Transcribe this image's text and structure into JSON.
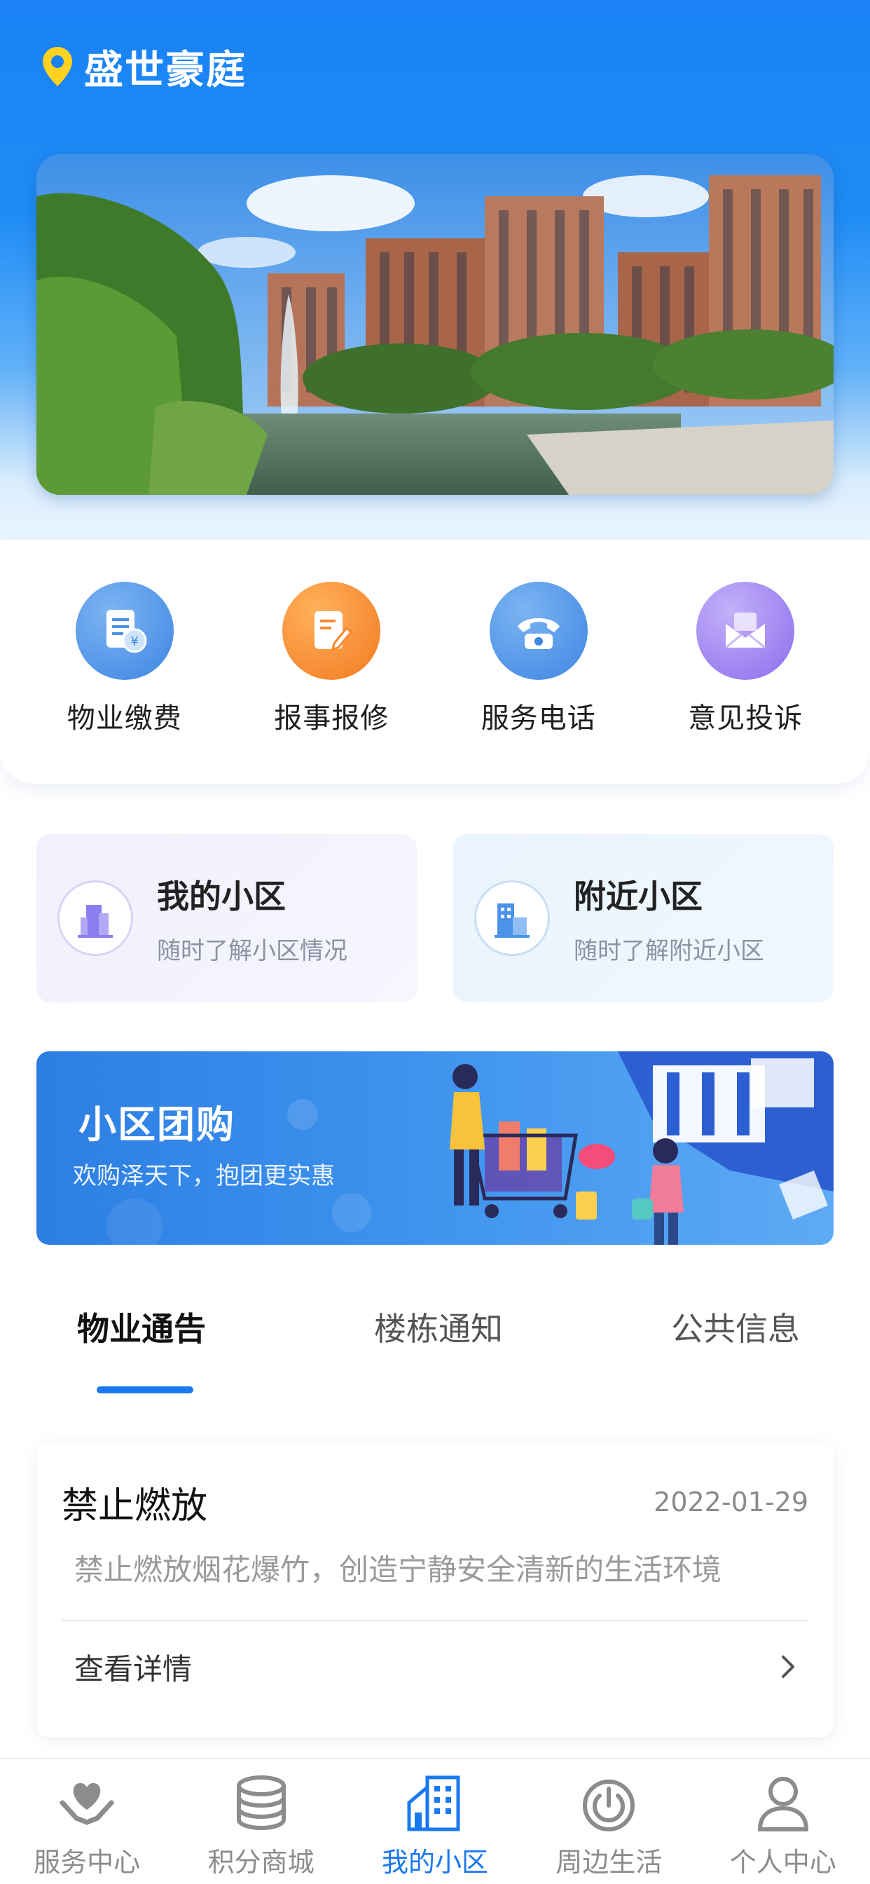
{
  "header": {
    "community_name": "盛世豪庭",
    "location_icon": "location-pin-icon"
  },
  "quick_actions": [
    {
      "label": "物业缴费",
      "icon": "bill-payment-icon",
      "color": "#4a93e8"
    },
    {
      "label": "报事报修",
      "icon": "repair-report-icon",
      "color": "#f5882d"
    },
    {
      "label": "服务电话",
      "icon": "telephone-icon",
      "color": "#4a93e8"
    },
    {
      "label": "意见投诉",
      "icon": "envelope-icon",
      "color": "#9a7df0"
    }
  ],
  "community_cards": [
    {
      "title": "我的小区",
      "subtitle": "随时了解小区情况",
      "icon": "building-icon"
    },
    {
      "title": "附近小区",
      "subtitle": "随时了解附近小区",
      "icon": "nearby-building-icon"
    }
  ],
  "group_buy": {
    "title": "小区团购",
    "subtitle": "欢购泽天下，抱团更实惠"
  },
  "tabs": [
    {
      "label": "物业通告",
      "active": true
    },
    {
      "label": "楼栋通知",
      "active": false
    },
    {
      "label": "公共信息",
      "active": false
    }
  ],
  "notice": {
    "title": "禁止燃放",
    "date": "2022-01-29",
    "body": "禁止燃放烟花爆竹，创造宁静安全清新的生活环境",
    "more_label": "查看详情"
  },
  "tabbar": [
    {
      "label": "服务中心",
      "icon": "heart-hands-icon",
      "active": false
    },
    {
      "label": "积分商城",
      "icon": "coins-stack-icon",
      "active": false
    },
    {
      "label": "我的小区",
      "icon": "house-icon",
      "active": true
    },
    {
      "label": "周边生活",
      "icon": "power-radar-icon",
      "active": false
    },
    {
      "label": "个人中心",
      "icon": "person-icon",
      "active": false
    }
  ],
  "colors": {
    "primary": "#1a78f0",
    "header_blue": "#1a82f5"
  }
}
